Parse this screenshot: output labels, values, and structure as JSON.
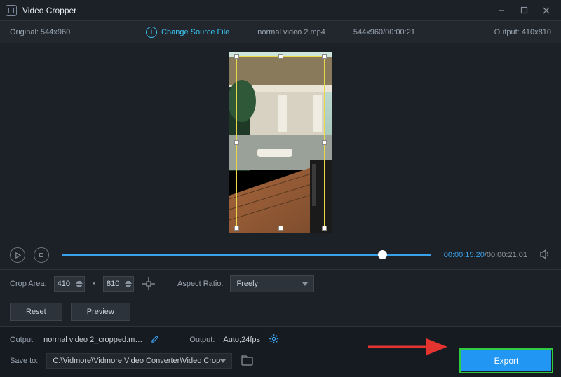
{
  "titlebar": {
    "title": "Video Cropper"
  },
  "infobar": {
    "original_label": "Original:  544x960",
    "change_source": "Change Source File",
    "filename": "normal video 2.mp4",
    "src_dims_dur": "544x960/00:00:21",
    "output_label": "Output: 410x810"
  },
  "player": {
    "current": "00:00:15.20",
    "duration": "/00:00:21.01"
  },
  "crop": {
    "area_label": "Crop Area:",
    "width": "410",
    "times": "×",
    "height": "810",
    "aspect_label": "Aspect Ratio:",
    "aspect_value": "Freely"
  },
  "actions": {
    "reset": "Reset",
    "preview": "Preview"
  },
  "bottom": {
    "output_label": "Output:",
    "output_file": "normal video 2_cropped.m…",
    "settings_label": "Output:",
    "settings_value": "Auto;24fps",
    "save_label": "Save to:",
    "save_path": "C:\\Vidmore\\Vidmore Video Converter\\Video Crop",
    "export": "Export"
  }
}
